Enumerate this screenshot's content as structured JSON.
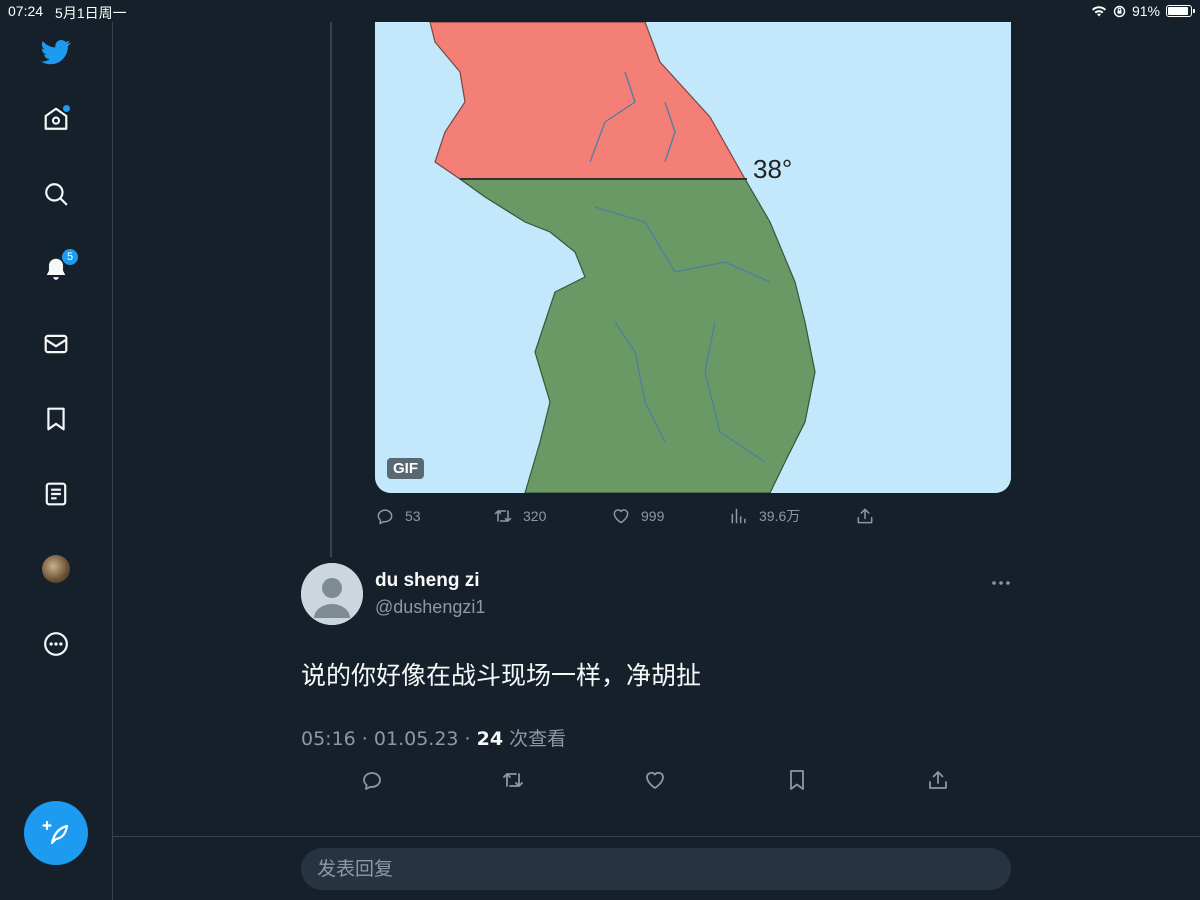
{
  "status_bar": {
    "time": "07:24",
    "date": "5月1日周一",
    "battery": "91%",
    "battery_level": 0.91
  },
  "sidebar": {
    "items": [
      {
        "name": "home",
        "icon": "home-icon",
        "has_dot": true
      },
      {
        "name": "explore",
        "icon": "search-icon"
      },
      {
        "name": "notifications",
        "icon": "bell-icon",
        "badge": "5"
      },
      {
        "name": "messages",
        "icon": "mail-icon"
      },
      {
        "name": "bookmarks",
        "icon": "bookmark-icon"
      },
      {
        "name": "lists",
        "icon": "list-icon"
      },
      {
        "name": "profile",
        "icon": "avatar"
      },
      {
        "name": "more",
        "icon": "more-circle-icon"
      }
    ]
  },
  "media": {
    "badge": "GIF",
    "map_label": "38°",
    "colors": {
      "sea": "#c3e8fb",
      "north": "#f47f77",
      "south": "#6a9966"
    }
  },
  "parent_actions": {
    "replies": "53",
    "retweets": "320",
    "likes": "999",
    "views": "39.6万"
  },
  "tweet": {
    "display_name": "du sheng zi",
    "handle": "@dushengzi1",
    "text": "说的你好像在战斗现场一样，净胡扯",
    "time": "05:16",
    "date": "01.05.23",
    "views_count": "24",
    "views_label": "次查看"
  },
  "reply": {
    "placeholder": "发表回复"
  },
  "theme": {
    "background": "#15202b",
    "accent": "#1d9bf0",
    "secondary_text": "#8b98a5",
    "border": "#38444d"
  }
}
